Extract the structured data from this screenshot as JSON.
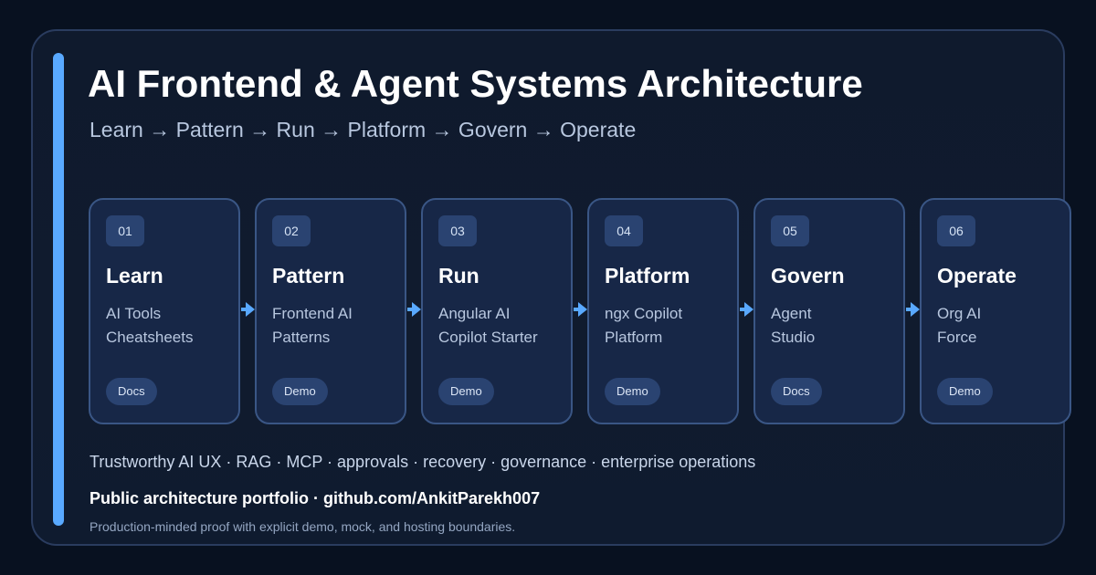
{
  "title": "AI Frontend & Agent Systems Architecture",
  "subtitle": "Learn → Pattern → Run → Platform → Govern → Operate",
  "colors": {
    "background": "#081120",
    "accent": "#59a9ff",
    "card_border": "#3a5685",
    "card_fill": "#172747",
    "badge_fill": "#2a4371"
  },
  "stages": [
    {
      "number": "01",
      "title": "Learn",
      "lines": [
        "AI Tools",
        "Cheatsheets"
      ],
      "tag": "Docs"
    },
    {
      "number": "02",
      "title": "Pattern",
      "lines": [
        "Frontend AI",
        "Patterns"
      ],
      "tag": "Demo"
    },
    {
      "number": "03",
      "title": "Run",
      "lines": [
        "Angular AI",
        "Copilot Starter"
      ],
      "tag": "Demo"
    },
    {
      "number": "04",
      "title": "Platform",
      "lines": [
        "ngx Copilot",
        "Platform"
      ],
      "tag": "Demo"
    },
    {
      "number": "05",
      "title": "Govern",
      "lines": [
        "Agent",
        "Studio"
      ],
      "tag": "Docs"
    },
    {
      "number": "06",
      "title": "Operate",
      "lines": [
        "Org AI",
        "Force"
      ],
      "tag": "Demo"
    }
  ],
  "arrow_icon": "arrow-right-icon",
  "tagline": "Trustworthy AI UX · RAG · MCP · approvals · recovery · governance · enterprise operations",
  "portfolio": "Public architecture portfolio · github.com/AnkitParekh007",
  "footnote": "Production-minded proof with explicit demo, mock, and hosting boundaries."
}
